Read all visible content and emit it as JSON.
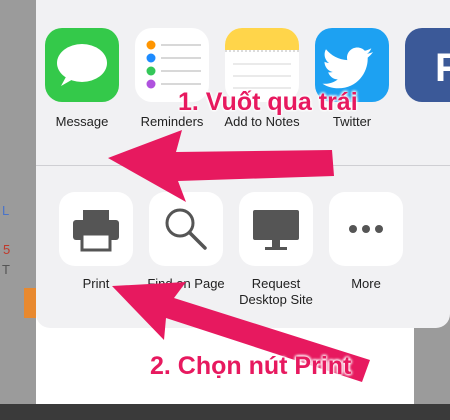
{
  "share_row": [
    {
      "label": "Message",
      "icon": "messages-icon"
    },
    {
      "label": "Reminders",
      "icon": "reminders-icon"
    },
    {
      "label": "Add to Notes",
      "icon": "notes-icon"
    },
    {
      "label": "Twitter",
      "icon": "twitter-icon"
    },
    {
      "label": "F",
      "icon": "facebook-icon"
    }
  ],
  "action_row": [
    {
      "label": "Print",
      "icon": "printer-icon"
    },
    {
      "label": "Find on Page",
      "icon": "search-icon"
    },
    {
      "label": "Request Desktop Site",
      "icon": "desktop-icon"
    },
    {
      "label": "More",
      "icon": "more-icon"
    }
  ],
  "annotations": {
    "step1": "1. Vuốt qua trái",
    "step2": "2. Chọn nút Print",
    "color": "#e7195f"
  },
  "background_peek": {
    "text1": "L",
    "text2": "5",
    "text3": "T"
  },
  "colors": {
    "messages": "#34c94a",
    "twitter": "#1da1f2",
    "notes": "#ffd54a",
    "link": "#1d6ff2"
  }
}
